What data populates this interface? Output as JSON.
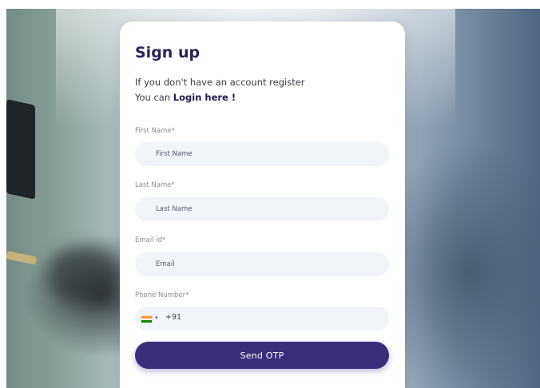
{
  "form": {
    "title": "Sign up",
    "intro_line1": "If you don't have an account register",
    "intro_prefix": "You can ",
    "login_link": "Login here !",
    "fields": [
      {
        "label": "First Name*",
        "placeholder": "First Name"
      },
      {
        "label": "Last Name*",
        "placeholder": "Last Name"
      },
      {
        "label": "Email id*",
        "placeholder": "Email"
      },
      {
        "label": "Phone Number*",
        "country_code": "+91"
      }
    ],
    "submit_label": "Send OTP"
  },
  "icons": {
    "flag": "india-flag-icon",
    "dropdown": "chevron-down-icon"
  },
  "colors": {
    "primary": "#3a2d7c",
    "field_bg": "#f1f4f9",
    "title": "#2b2358"
  }
}
